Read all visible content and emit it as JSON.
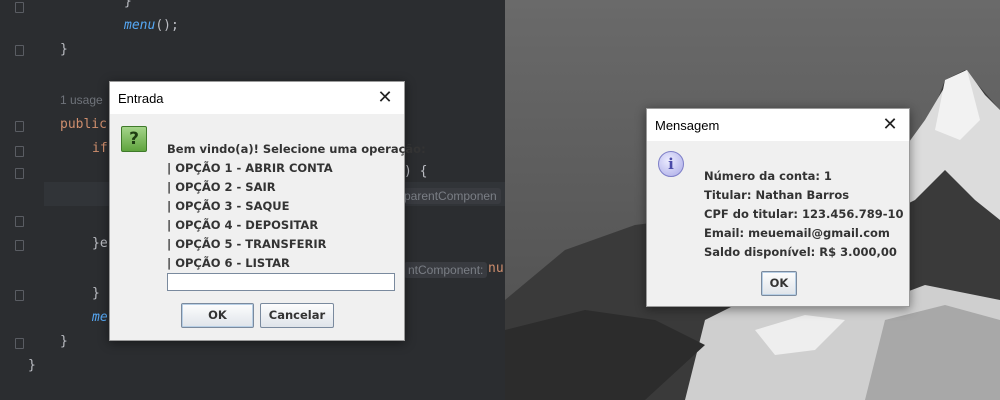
{
  "ide": {
    "lines": {
      "l1": "}",
      "l2_fn": "menu",
      "l2_rest": "();",
      "l3": "}",
      "l4_usages": "1 usage",
      "l5_kw": "public",
      "l6_kw": "if",
      "l7": ") {",
      "l8_hint": "parentComponen",
      "l10": "}e",
      "l11_hint": "ntComponent:",
      "l11_tail": "nu",
      "l13": "}",
      "l14": "me",
      "l15": "}",
      "l16": "}"
    }
  },
  "input_dialog": {
    "title": "Entrada",
    "close_glyph": "✕",
    "icon_glyph": "?",
    "lines": [
      "Bem vindo(a)! Selecione uma operação:",
      "| OPÇÃO 1 - ABRIR CONTA",
      "| OPÇÃO 2 - SAIR",
      "| OPÇÃO 3 - SAQUE",
      "| OPÇÃO 4 - DEPOSITAR",
      "| OPÇÃO 5 - TRANSFERIR",
      "| OPÇÃO 6 - LISTAR"
    ],
    "input_value": "",
    "ok_label": "OK",
    "cancel_label": "Cancelar"
  },
  "message_dialog": {
    "title": "Mensagem",
    "close_glyph": "✕",
    "icon_glyph": "i",
    "lines": [
      "Número da conta: 1",
      "Titular: Nathan Barros",
      "CPF do titular: 123.456.789-10",
      "Email: meuemail@gmail.com",
      "Saldo disponível: R$ 3.000,00"
    ],
    "ok_label": "OK"
  },
  "colors": {
    "ide_bg": "#2b2d30",
    "keyword": "#cf8e6d",
    "method": "#56a8f5",
    "dialog_bg": "#f0f0f0",
    "question_icon": "#6bb04a",
    "info_icon": "#7e7fc8"
  }
}
